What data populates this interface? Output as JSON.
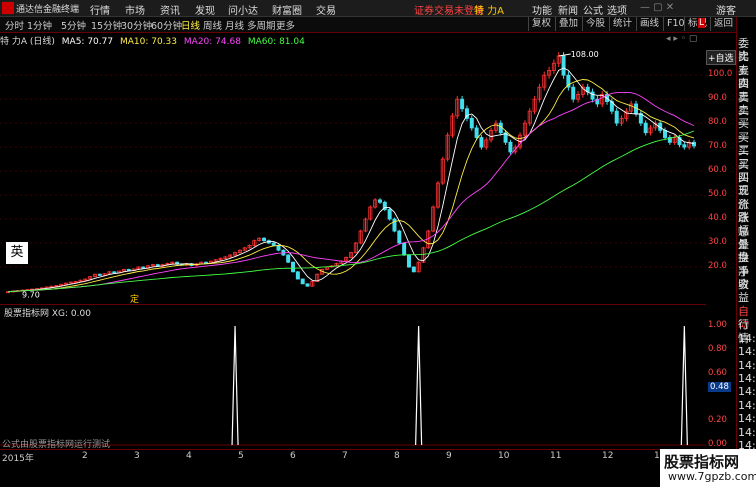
{
  "menubar": {
    "app_title": "通达信金融终端",
    "items": [
      "行情",
      "市场",
      "资讯",
      "发现",
      "问小达",
      "财富圈",
      "交易"
    ],
    "warning": "证券交易未登录",
    "stock": "特 力A",
    "right_items": [
      "功能",
      "新闻",
      "公式",
      "选项"
    ],
    "user": "游客"
  },
  "periods": [
    "分时",
    "1分钟",
    "5分钟",
    "15分钟",
    "30分钟",
    "60分钟",
    "日线",
    "周线",
    "月线",
    "多周期",
    "更多"
  ],
  "active_period": "日线",
  "toolbar_right": [
    "复权",
    "叠加",
    "今股",
    "统计",
    "画线",
    "F10",
    "标记",
    "返回"
  ],
  "stock_label": "特 力A (日线)",
  "ma": [
    {
      "label": "MA5: 70.77",
      "color": "#ffffff"
    },
    {
      "label": "MA10: 70.33",
      "color": "#ffee44"
    },
    {
      "label": "MA20: 74.68",
      "color": "#ff44ff"
    },
    {
      "label": "MA60: 81.04",
      "color": "#44ff44"
    }
  ],
  "add_watch": "+自选",
  "price_axis": [
    "100.0",
    "90.0",
    "80.0",
    "70.0",
    "60.0",
    "50.0",
    "40.0",
    "30.0",
    "20.0"
  ],
  "high_label": "108.00",
  "low_label": "9.70",
  "ding_label": "定",
  "eng_label": "英",
  "ind_header": "股票指标网  XG: 0.00",
  "ind_axis": [
    "1.00",
    "0.80",
    "0.60",
    "0.48",
    "0.20",
    "0.00"
  ],
  "ind_cursor": "0.48",
  "bottom_labels": [
    "2015年",
    "2",
    "3",
    "4",
    "5",
    "6",
    "7",
    "8",
    "9",
    "10",
    "11",
    "12",
    "1"
  ],
  "formula_note": "公式由股票指标网运行测试",
  "right_panel": [
    "委比",
    "卖五",
    "卖四",
    "卖三",
    "卖二",
    "卖一",
    "买一",
    "买二",
    "买三",
    "买四",
    "买五",
    "现价",
    "涨跌",
    "涨幅",
    "总量",
    "外盘",
    "换手",
    "净资",
    "收益"
  ],
  "right_panel_lower": [
    "自动",
    "行情",
    "14:5",
    "14:5",
    "14:5",
    "14:5",
    "14:5",
    "14:5",
    "14:5",
    "14:5",
    "14:5",
    "14:5",
    "14:5"
  ],
  "watermark_title": "股票指标网",
  "watermark_url": "www.7gpzb.com",
  "chart_data": {
    "type": "candlestick",
    "note_x": "trading days",
    "close": [
      9.7,
      10,
      10.2,
      10.4,
      10.6,
      10.8,
      11,
      11.3,
      11.7,
      12,
      12.3,
      12.8,
      13.3,
      13.7,
      14,
      14.5,
      15,
      16,
      17,
      16.5,
      17.2,
      18,
      17.6,
      18.3,
      19,
      18.5,
      19.2,
      20,
      19.5,
      20.5,
      21,
      20.3,
      21,
      21.5,
      22,
      21.2,
      20.8,
      21.4,
      20.6,
      21.3,
      22,
      21.6,
      22.4,
      23,
      23.6,
      24.2,
      25,
      26,
      27,
      28,
      29,
      31,
      32,
      31,
      30,
      29,
      27,
      25,
      22,
      18,
      15,
      13,
      12,
      14,
      17,
      19,
      20,
      20.5,
      21.5,
      22.5,
      24,
      26,
      30,
      35,
      40,
      45,
      48,
      47,
      44,
      40,
      35,
      30,
      25,
      20,
      18,
      22,
      28,
      35,
      45,
      55,
      65,
      75,
      83,
      90,
      86,
      82,
      78,
      74,
      70,
      73,
      77,
      80,
      76,
      72,
      68,
      70,
      75,
      80,
      85,
      90,
      95,
      100,
      102,
      105,
      108,
      100,
      95,
      90,
      92,
      95,
      93,
      90,
      88,
      92,
      89,
      85,
      80,
      82,
      85,
      88,
      84,
      80,
      76,
      78,
      80,
      77,
      74,
      72,
      74,
      71,
      70,
      72,
      70.5
    ],
    "ma60_end": 81.04,
    "indicator_spikes_at_days": [
      47,
      85,
      140
    ],
    "indicator_range": [
      0,
      1
    ]
  }
}
